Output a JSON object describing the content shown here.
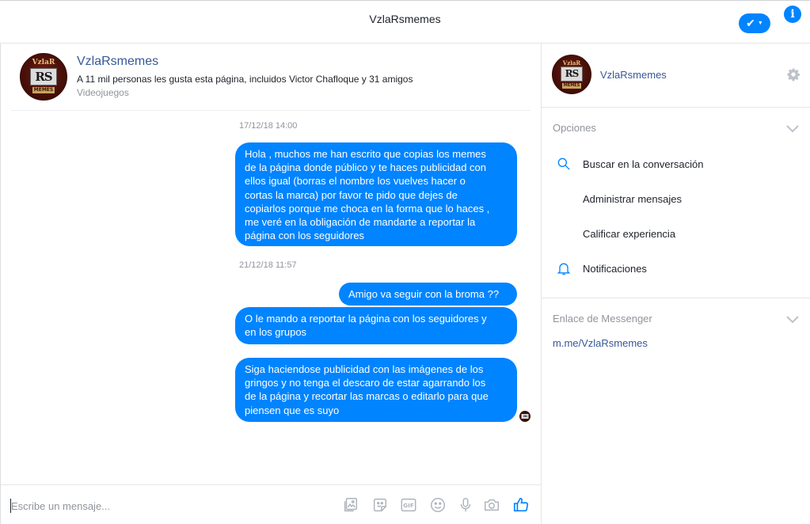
{
  "topbar": {
    "title": "VzlaRsmemes"
  },
  "avatar": {
    "top_text": "VzlaR",
    "mid_text": "RS",
    "bottom_text": "MEMES"
  },
  "page": {
    "name": "VzlaRsmemes",
    "likes": "A 11 mil personas les gusta esta página, incluidos Victor Chafloque y 31 amigos",
    "category": "Videojuegos"
  },
  "messages": [
    {
      "type": "timestamp",
      "text": "17/12/18 14:00"
    },
    {
      "type": "bubble",
      "lines": [
        "Hola ,  muchos me han escrito que copias los memes",
        "de la página donde público y te haces publicidad con",
        "ellos igual (borras el nombre los vuelves hacer o",
        "cortas la marca) por favor te pido que dejes de",
        "copiarlos porque me choca en la forma que lo haces ,",
        "me veré en la obligación de mandarte a reportar la",
        "página con los seguidores"
      ]
    },
    {
      "type": "timestamp",
      "text": "21/12/18 11:57"
    },
    {
      "type": "bubble",
      "lines": [
        "Amigo va seguir con la broma ??"
      ]
    },
    {
      "type": "bubble",
      "lines": [
        "O le mando a reportar la página con los seguidores y",
        "en los grupos"
      ]
    },
    {
      "type": "bubble",
      "lines": [
        "Siga haciendose publicidad con las imágenes de los",
        "gringos y no tenga el descaro de estar agarrando los",
        "de la página y recortar las marcas o editarlo para que",
        "piensen que es suyo"
      ]
    }
  ],
  "composer": {
    "placeholder": "Escribe un mensaje...",
    "icons": [
      "photo-icon",
      "sticker-icon",
      "gif-icon",
      "emoji-icon",
      "microphone-icon",
      "camera-icon",
      "like-icon"
    ],
    "gif_label": "GIF"
  },
  "right_panel": {
    "name": "VzlaRsmemes",
    "options_label": "Opciones",
    "options": [
      {
        "label": "Buscar en la conversación",
        "icon": "search-icon"
      },
      {
        "label": "Administrar mensajes",
        "icon": ""
      },
      {
        "label": "Calificar experiencia",
        "icon": ""
      },
      {
        "label": "Notificaciones",
        "icon": "bell-icon"
      }
    ],
    "link_section_label": "Enlace de Messenger",
    "link": "m.me/VzlaRsmemes"
  },
  "colors": {
    "accent": "#0084ff",
    "link": "#365899",
    "muted": "#90949c"
  }
}
